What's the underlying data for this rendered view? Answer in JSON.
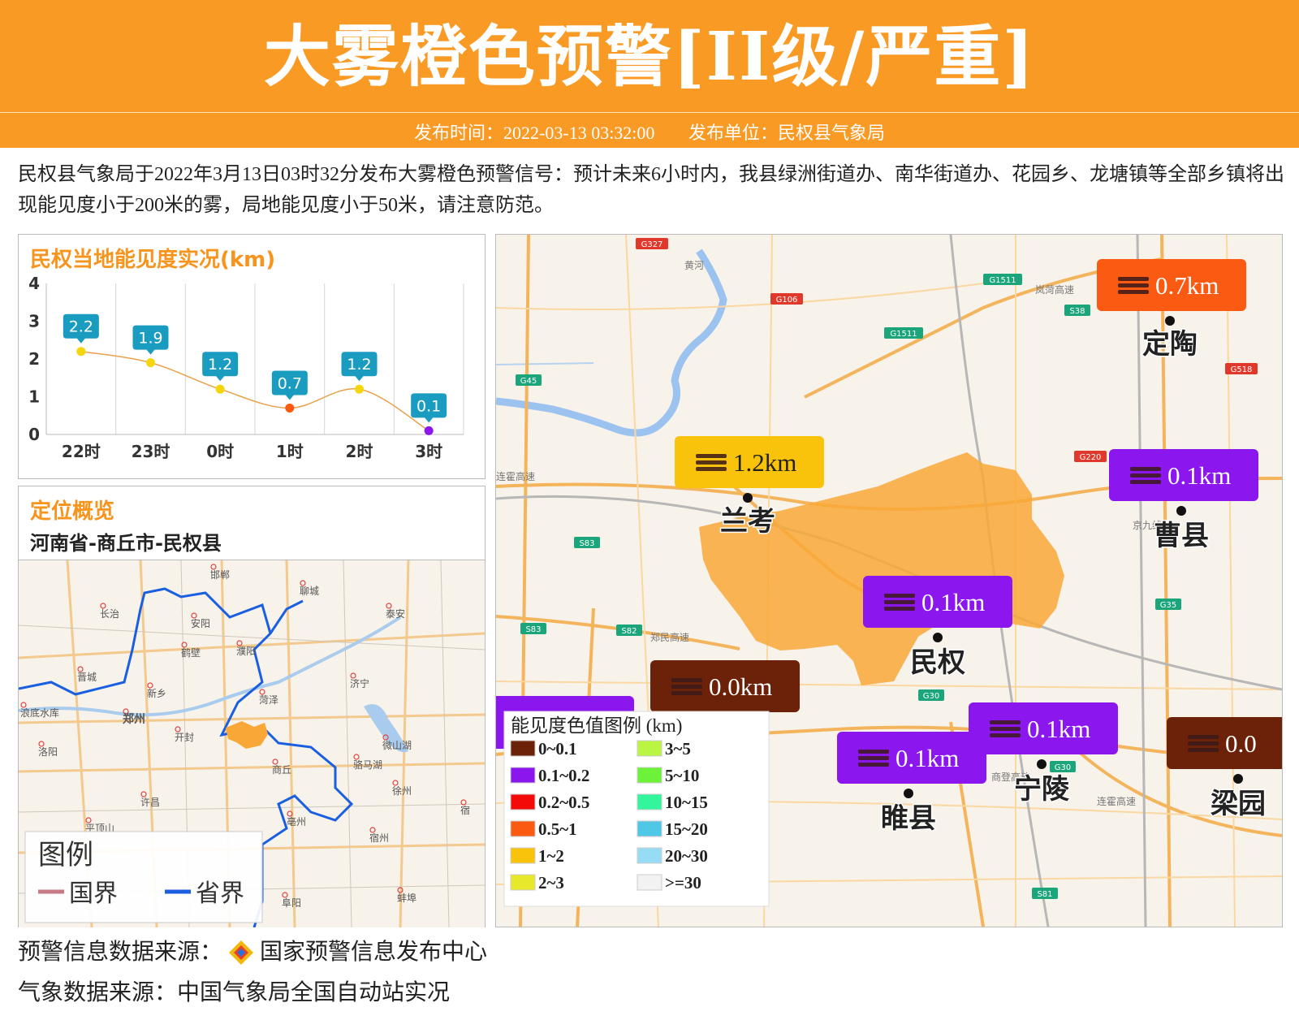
{
  "header": {
    "title": "大雾橙色预警[II级/严重]",
    "time_label": "发布时间：2022-03-13 03:32:00",
    "unit_label": "发布单位：民权县气象局",
    "color": "#f99a25"
  },
  "description": "民权县气象局于2022年3月13日03时32分发布大雾橙色预警信号：预计未来6小时内，我县绿洲街道办、南华街道办、花园乡、龙塘镇等全部乡镇将出现能见度小于200米的雾，局地能见度小于50米，请注意防范。",
  "chart_panel": {
    "title": "民权当地能见度实况(km)"
  },
  "chart_data": {
    "type": "line",
    "categories": [
      "22时",
      "23时",
      "0时",
      "1时",
      "2时",
      "3时"
    ],
    "values": [
      2.2,
      1.9,
      1.2,
      0.7,
      1.2,
      0.1
    ],
    "labels": [
      "2.2",
      "1.9",
      "1.2",
      "0.7",
      "1.2",
      "0.1"
    ],
    "point_colors": [
      "#f5d60c",
      "#f5d60c",
      "#f5d60c",
      "#fb5a12",
      "#f5d60c",
      "#8b17ee"
    ],
    "ylim": [
      0,
      4
    ],
    "yticks": [
      0,
      1,
      2,
      3,
      4
    ],
    "label_color": "#1a9cc1",
    "line_color": "#e8a24a",
    "grid": true
  },
  "location_panel": {
    "title": "定位概览",
    "path": "河南省-商丘市-民权县"
  },
  "overview_map": {
    "legend_title": "图例",
    "legend_items": [
      {
        "label": "国界",
        "color": "#c87a86"
      },
      {
        "label": "省界",
        "color": "#1a5fe0"
      }
    ],
    "cities": [
      "邯郸",
      "长治",
      "安阳",
      "鹤壁",
      "濮阳",
      "聊城",
      "泰安",
      "晋城",
      "新乡",
      "菏泽",
      "济宁",
      "郑州",
      "开封",
      "洛阳",
      "商丘",
      "微山湖",
      "徐州",
      "许昌",
      "亳州",
      "宿州",
      "平顶山",
      "阜阳",
      "蚌埠",
      "浪底水库",
      "骆马湖",
      "宿"
    ]
  },
  "main_map": {
    "stations": [
      {
        "name": "定陶",
        "value": "0.7km",
        "color": "#fb5a12"
      },
      {
        "name": "兰考",
        "value": "1.2km",
        "color": "#f9c20b"
      },
      {
        "name": "曹县",
        "value": "0.1km",
        "color": "#8b17ee"
      },
      {
        "name": "民权",
        "value": "0.1km",
        "color": "#8b17ee"
      },
      {
        "name": "",
        "value": "0.0km",
        "color": "#6b2208"
      },
      {
        "name": "睢县",
        "value": "0.1km",
        "color": "#8b17ee"
      },
      {
        "name": "宁陵",
        "value": "0.1km",
        "color": "#8b17ee"
      },
      {
        "name": "梁园",
        "value": "0.0",
        "color": "#6b2208"
      }
    ],
    "road_labels": [
      "G327",
      "G1511",
      "G106",
      "S38",
      "G45",
      "G518",
      "G220",
      "G1511",
      "S83",
      "S82",
      "S83",
      "G35",
      "G30",
      "G30",
      "S81",
      "岚菏高速",
      "连霍高速",
      "郑民高速",
      "商登高速",
      "连霍高速",
      "黄河",
      "京九线"
    ],
    "region_color": "#f9a837"
  },
  "legend": {
    "title": "能见度色值图例 (km)",
    "items": [
      {
        "label": "0~0.1",
        "color": "#6b2208"
      },
      {
        "label": "0.1~0.2",
        "color": "#8b17ee"
      },
      {
        "label": "0.2~0.5",
        "color": "#f50a0a"
      },
      {
        "label": "0.5~1",
        "color": "#fb5a12"
      },
      {
        "label": "1~2",
        "color": "#f9c20b"
      },
      {
        "label": "2~3",
        "color": "#e8e82a"
      },
      {
        "label": "3~5",
        "color": "#b9f542"
      },
      {
        "label": "5~10",
        "color": "#6df23a"
      },
      {
        "label": "10~15",
        "color": "#33f59c"
      },
      {
        "label": "15~20",
        "color": "#4fc8e8"
      },
      {
        "label": "20~30",
        "color": "#97dcf5"
      },
      {
        "label": ">=30",
        "color": "#f2f2f2"
      }
    ]
  },
  "footer": {
    "warning_source": "预警信息数据来源：",
    "warning_source_name": "国家预警信息发布中心",
    "weather_source": "气象数据来源：中国气象局全国自动站实况"
  }
}
